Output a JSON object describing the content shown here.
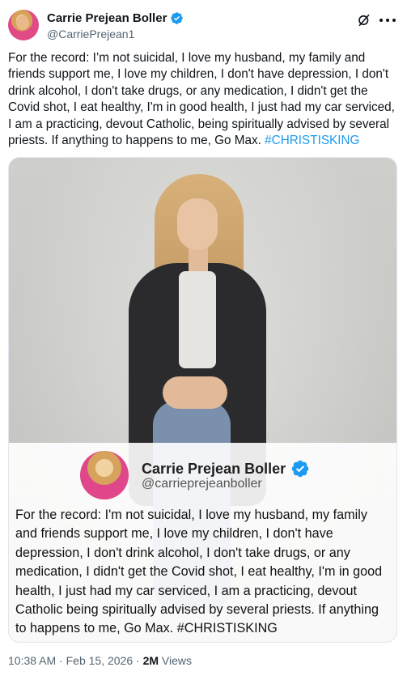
{
  "author": {
    "display_name": "Carrie Prejean Boller",
    "handle": "@CarriePrejean1"
  },
  "tweet": {
    "text": "For the record: I’m not suicidal, I love my husband, my family and friends support me, I love my children, I don't have depression, I don't drink alcohol, I don't take drugs, or any medication, I didn't get the Covid shot, I eat healthy, I'm in good health, I just had my car serviced, I am a practicing, devout Catholic, being spiritually advised by several priests. If anything to happens to me, Go Max.",
    "hashtag": "#CHRISTISKING"
  },
  "media_overlay": {
    "display_name": "Carrie Prejean Boller",
    "handle": "@carrieprejeanboller",
    "text": "For the record: I'm not suicidal, I love my husband, my family and friends support me, I love my children, I don't have depression, I don't drink alcohol, I don't take drugs, or any medication, I didn't get the Covid shot, I eat healthy, I'm in good health, I just had my car serviced, I am a practicing, devout Catholic being spiritually advised by several priests. If anything to happens to me, Go Max. #CHRISTISKING"
  },
  "meta": {
    "time": "10:38 AM",
    "separator": " · ",
    "date": "Feb 15, 2026",
    "views_count": "2M",
    "views_label": " Views"
  },
  "icons": {
    "verified": "verified-badge-icon",
    "grok": "grok-icon",
    "more": "more-icon"
  },
  "colors": {
    "accent": "#1d9bf0",
    "text": "#0f1419",
    "secondary": "#536471"
  }
}
